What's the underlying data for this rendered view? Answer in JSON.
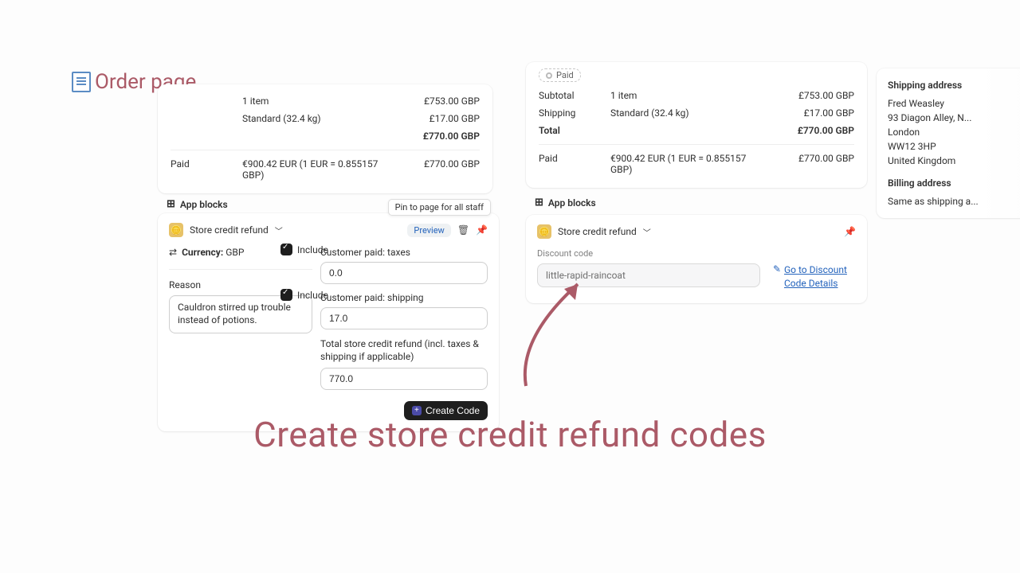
{
  "page_label": "Order page",
  "order_left": {
    "item_count": "1 item",
    "item_price": "£753.00 GBP",
    "shipping_label": "Standard",
    "shipping_weight": "(32.4 kg)",
    "shipping_price": "£17.00 GBP",
    "total_price": "£770.00 GBP",
    "paid_label": "Paid",
    "paid_conv": "€900.42 EUR (1 EUR = 0.855157 GBP)",
    "paid_total": "£770.00 GBP"
  },
  "order_right": {
    "paid_badge": "Paid",
    "subtotal_label": "Subtotal",
    "item_count": "1 item",
    "item_price": "£753.00 GBP",
    "shipping_label": "Shipping",
    "shipping_method": "Standard (32.4 kg)",
    "shipping_price": "£17.00 GBP",
    "total_label": "Total",
    "total_price": "£770.00 GBP",
    "paid_label": "Paid",
    "paid_conv": "€900.42 EUR (1 EUR = 0.855157 GBP)",
    "paid_total": "£770.00 GBP"
  },
  "shipping_card": {
    "shipping_header": "Shipping address",
    "line1": "Fred Weasley",
    "line2": "93 Diagon Alley, N...",
    "line3": "London",
    "line4": "WW12 3HP",
    "line5": "United Kingdom",
    "billing_header": "Billing address",
    "billing_text": "Same as shipping a..."
  },
  "app_blocks_label": "App blocks",
  "tooltip_pin": "Pin to page for all staff",
  "refund_left": {
    "title": "Store credit refund",
    "preview_label": "Preview",
    "currency_label": "Currency:",
    "currency_value": "GBP",
    "reason_label": "Reason",
    "reason_value": "Cauldron stirred up trouble instead of potions.",
    "include_label": "Include",
    "taxes_label": "Customer paid: taxes",
    "taxes_value": "0.0",
    "shipping_label": "Customer paid: shipping",
    "shipping_value": "17.0",
    "total_label": "Total store credit refund (incl. taxes & shipping if applicable)",
    "total_value": "770.0",
    "create_btn": "Create Code"
  },
  "refund_right": {
    "title": "Store credit refund",
    "discount_label": "Discount code",
    "discount_value": "little-rapid-raincoat",
    "link_text": "Go to Discount Code Details"
  },
  "headline": "Create store credit refund codes"
}
